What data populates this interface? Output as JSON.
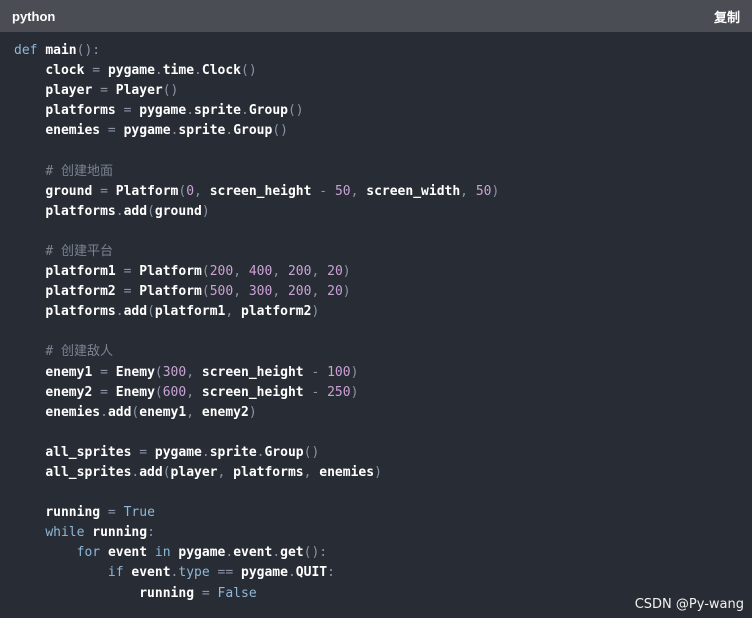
{
  "header": {
    "language": "python",
    "copy_label": "复制"
  },
  "watermark": "CSDN @Py-wang",
  "colors": {
    "background": "#282c34",
    "header": "#4a4d53",
    "keyword": "#8fb8d8",
    "number": "#c9a2d6",
    "comment": "#7b8292"
  },
  "code_lines": [
    [
      [
        "kw",
        "def"
      ],
      [
        "pl",
        " "
      ],
      [
        "fn",
        "main"
      ],
      [
        "pu",
        "():"
      ]
    ],
    [
      [
        "pl",
        "    "
      ],
      [
        "id",
        "clock"
      ],
      [
        "pu",
        " = "
      ],
      [
        "id",
        "pygame"
      ],
      [
        "pu",
        "."
      ],
      [
        "id",
        "time"
      ],
      [
        "pu",
        "."
      ],
      [
        "id",
        "Clock"
      ],
      [
        "pu",
        "()"
      ]
    ],
    [
      [
        "pl",
        "    "
      ],
      [
        "id",
        "player"
      ],
      [
        "pu",
        " = "
      ],
      [
        "id",
        "Player"
      ],
      [
        "pu",
        "()"
      ]
    ],
    [
      [
        "pl",
        "    "
      ],
      [
        "id",
        "platforms"
      ],
      [
        "pu",
        " = "
      ],
      [
        "id",
        "pygame"
      ],
      [
        "pu",
        "."
      ],
      [
        "id",
        "sprite"
      ],
      [
        "pu",
        "."
      ],
      [
        "id",
        "Group"
      ],
      [
        "pu",
        "()"
      ]
    ],
    [
      [
        "pl",
        "    "
      ],
      [
        "id",
        "enemies"
      ],
      [
        "pu",
        " = "
      ],
      [
        "id",
        "pygame"
      ],
      [
        "pu",
        "."
      ],
      [
        "id",
        "sprite"
      ],
      [
        "pu",
        "."
      ],
      [
        "id",
        "Group"
      ],
      [
        "pu",
        "()"
      ]
    ],
    [],
    [
      [
        "pl",
        "    "
      ],
      [
        "co",
        "# 创建地面"
      ]
    ],
    [
      [
        "pl",
        "    "
      ],
      [
        "id",
        "ground"
      ],
      [
        "pu",
        " = "
      ],
      [
        "id",
        "Platform"
      ],
      [
        "pu",
        "("
      ],
      [
        "nu",
        "0"
      ],
      [
        "pu",
        ", "
      ],
      [
        "id",
        "screen_height"
      ],
      [
        "pu",
        " - "
      ],
      [
        "nu",
        "50"
      ],
      [
        "pu",
        ", "
      ],
      [
        "id",
        "screen_width"
      ],
      [
        "pu",
        ", "
      ],
      [
        "nu",
        "50"
      ],
      [
        "pu",
        ")"
      ]
    ],
    [
      [
        "pl",
        "    "
      ],
      [
        "id",
        "platforms"
      ],
      [
        "pu",
        "."
      ],
      [
        "id",
        "add"
      ],
      [
        "pu",
        "("
      ],
      [
        "id",
        "ground"
      ],
      [
        "pu",
        ")"
      ]
    ],
    [],
    [
      [
        "pl",
        "    "
      ],
      [
        "co",
        "# 创建平台"
      ]
    ],
    [
      [
        "pl",
        "    "
      ],
      [
        "id",
        "platform1"
      ],
      [
        "pu",
        " = "
      ],
      [
        "id",
        "Platform"
      ],
      [
        "pu",
        "("
      ],
      [
        "nu",
        "200"
      ],
      [
        "pu",
        ", "
      ],
      [
        "nu",
        "400"
      ],
      [
        "pu",
        ", "
      ],
      [
        "nu",
        "200"
      ],
      [
        "pu",
        ", "
      ],
      [
        "nu",
        "20"
      ],
      [
        "pu",
        ")"
      ]
    ],
    [
      [
        "pl",
        "    "
      ],
      [
        "id",
        "platform2"
      ],
      [
        "pu",
        " = "
      ],
      [
        "id",
        "Platform"
      ],
      [
        "pu",
        "("
      ],
      [
        "nu",
        "500"
      ],
      [
        "pu",
        ", "
      ],
      [
        "nu",
        "300"
      ],
      [
        "pu",
        ", "
      ],
      [
        "nu",
        "200"
      ],
      [
        "pu",
        ", "
      ],
      [
        "nu",
        "20"
      ],
      [
        "pu",
        ")"
      ]
    ],
    [
      [
        "pl",
        "    "
      ],
      [
        "id",
        "platforms"
      ],
      [
        "pu",
        "."
      ],
      [
        "id",
        "add"
      ],
      [
        "pu",
        "("
      ],
      [
        "id",
        "platform1"
      ],
      [
        "pu",
        ", "
      ],
      [
        "id",
        "platform2"
      ],
      [
        "pu",
        ")"
      ]
    ],
    [],
    [
      [
        "pl",
        "    "
      ],
      [
        "co",
        "# 创建敌人"
      ]
    ],
    [
      [
        "pl",
        "    "
      ],
      [
        "id",
        "enemy1"
      ],
      [
        "pu",
        " = "
      ],
      [
        "id",
        "Enemy"
      ],
      [
        "pu",
        "("
      ],
      [
        "nu",
        "300"
      ],
      [
        "pu",
        ", "
      ],
      [
        "id",
        "screen_height"
      ],
      [
        "pu",
        " - "
      ],
      [
        "nu",
        "100"
      ],
      [
        "pu",
        ")"
      ]
    ],
    [
      [
        "pl",
        "    "
      ],
      [
        "id",
        "enemy2"
      ],
      [
        "pu",
        " = "
      ],
      [
        "id",
        "Enemy"
      ],
      [
        "pu",
        "("
      ],
      [
        "nu",
        "600"
      ],
      [
        "pu",
        ", "
      ],
      [
        "id",
        "screen_height"
      ],
      [
        "pu",
        " - "
      ],
      [
        "nu",
        "250"
      ],
      [
        "pu",
        ")"
      ]
    ],
    [
      [
        "pl",
        "    "
      ],
      [
        "id",
        "enemies"
      ],
      [
        "pu",
        "."
      ],
      [
        "id",
        "add"
      ],
      [
        "pu",
        "("
      ],
      [
        "id",
        "enemy1"
      ],
      [
        "pu",
        ", "
      ],
      [
        "id",
        "enemy2"
      ],
      [
        "pu",
        ")"
      ]
    ],
    [],
    [
      [
        "pl",
        "    "
      ],
      [
        "id",
        "all_sprites"
      ],
      [
        "pu",
        " = "
      ],
      [
        "id",
        "pygame"
      ],
      [
        "pu",
        "."
      ],
      [
        "id",
        "sprite"
      ],
      [
        "pu",
        "."
      ],
      [
        "id",
        "Group"
      ],
      [
        "pu",
        "()"
      ]
    ],
    [
      [
        "pl",
        "    "
      ],
      [
        "id",
        "all_sprites"
      ],
      [
        "pu",
        "."
      ],
      [
        "id",
        "add"
      ],
      [
        "pu",
        "("
      ],
      [
        "id",
        "player"
      ],
      [
        "pu",
        ", "
      ],
      [
        "id",
        "platforms"
      ],
      [
        "pu",
        ", "
      ],
      [
        "id",
        "enemies"
      ],
      [
        "pu",
        ")"
      ]
    ],
    [],
    [
      [
        "pl",
        "    "
      ],
      [
        "id",
        "running"
      ],
      [
        "pu",
        " = "
      ],
      [
        "bi",
        "True"
      ]
    ],
    [
      [
        "pl",
        "    "
      ],
      [
        "kw",
        "while"
      ],
      [
        "pl",
        " "
      ],
      [
        "id",
        "running"
      ],
      [
        "pu",
        ":"
      ]
    ],
    [
      [
        "pl",
        "        "
      ],
      [
        "kw",
        "for"
      ],
      [
        "pl",
        " "
      ],
      [
        "id",
        "event"
      ],
      [
        "pl",
        " "
      ],
      [
        "kw",
        "in"
      ],
      [
        "pl",
        " "
      ],
      [
        "id",
        "pygame"
      ],
      [
        "pu",
        "."
      ],
      [
        "id",
        "event"
      ],
      [
        "pu",
        "."
      ],
      [
        "id",
        "get"
      ],
      [
        "pu",
        "():"
      ]
    ],
    [
      [
        "pl",
        "            "
      ],
      [
        "kw",
        "if"
      ],
      [
        "pl",
        " "
      ],
      [
        "id",
        "event"
      ],
      [
        "pu",
        "."
      ],
      [
        "kw",
        "type"
      ],
      [
        "pu",
        " == "
      ],
      [
        "id",
        "pygame"
      ],
      [
        "pu",
        "."
      ],
      [
        "id",
        "QUIT"
      ],
      [
        "pu",
        ":"
      ]
    ],
    [
      [
        "pl",
        "                "
      ],
      [
        "id",
        "running"
      ],
      [
        "pu",
        " = "
      ],
      [
        "bi",
        "False"
      ]
    ]
  ]
}
